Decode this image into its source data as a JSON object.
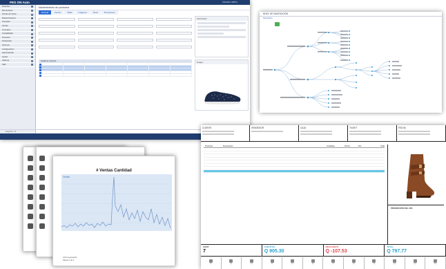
{
  "erp": {
    "logo": "PEG ON Auto",
    "user": "Usuario activo",
    "title": "Mantenimiento de productos",
    "tabs": [
      {
        "label": "General"
      },
      {
        "label": "Precios"
      },
      {
        "label": "Tallas"
      },
      {
        "label": "Imágenes"
      },
      {
        "label": "Stock"
      },
      {
        "label": "Proveedores"
      }
    ],
    "sidebar": [
      {
        "label": "Favoritos"
      },
      {
        "label": "Mis archivos"
      },
      {
        "label": "Puntos de Venta"
      },
      {
        "label": "Mantenimientos"
      },
      {
        "label": "Compras"
      },
      {
        "label": "Ventas"
      },
      {
        "label": "Inventario"
      },
      {
        "label": "Contabilidad"
      },
      {
        "label": "Tesorería"
      },
      {
        "label": "Producción"
      },
      {
        "label": "Informes"
      },
      {
        "label": "Configuración"
      },
      {
        "label": "Herramientas"
      },
      {
        "label": "Ayuda"
      },
      {
        "label": "Sistema"
      },
      {
        "label": "Salir"
      }
    ],
    "panel_right_title": "Información",
    "grid_title": "Detalle de artículos",
    "product_panel_title": "Imagen",
    "footer": "Registros: 12"
  },
  "tree": {
    "title": "NIVEL DE NAVEGACIÓN",
    "tabs": "Descripción",
    "nodes": [
      {
        "label": "Categoría"
      },
      {
        "label": "Calzado"
      },
      {
        "label": "Ropa"
      },
      {
        "label": "Accesorios"
      }
    ]
  },
  "report": {
    "chart_title": "# Ventas Cantidad",
    "legend": "Ventas",
    "footer_lines": [
      "Informe generado",
      "Página 1 de 3"
    ]
  },
  "pos": {
    "top_boxes": [
      {
        "label": "CLIENTE"
      },
      {
        "label": "VENDEDOR"
      },
      {
        "label": "CAJA"
      },
      {
        "label": "TICKET"
      },
      {
        "label": "FECHA"
      }
    ],
    "table_headers": [
      "Producto",
      "Descripción",
      "Unidades",
      "Precio",
      "Dto",
      "Total"
    ],
    "rows": [
      {
        "p": "",
        "d": "",
        "u": "",
        "pr": "",
        "dt": "",
        "t": ""
      },
      {
        "p": "",
        "d": "",
        "u": "",
        "pr": "",
        "dt": "",
        "t": ""
      },
      {
        "p": "",
        "d": "",
        "u": "",
        "pr": "",
        "dt": "",
        "t": ""
      },
      {
        "p": "",
        "d": "",
        "u": "",
        "pr": "",
        "dt": "",
        "t": ""
      },
      {
        "p": "",
        "d": "",
        "u": "",
        "pr": "",
        "dt": "",
        "t": ""
      },
      {
        "p": "",
        "d": "",
        "u": "",
        "pr": "",
        "dt": "",
        "t": ""
      },
      {
        "p": "",
        "d": "",
        "u": "",
        "pr": "",
        "dt": "",
        "t": ""
      },
      {
        "p": "",
        "d": "",
        "u": "",
        "pr": "",
        "dt": "",
        "t": ""
      }
    ],
    "promo_label": "PROMOCIÓN DEL DÍA",
    "totals": [
      {
        "label": "CANT",
        "value": "7",
        "style": "dark"
      },
      {
        "label": "SUBTOTAL",
        "value": "Q 905.30",
        "style": "blue"
      },
      {
        "label": "DESCUENTO",
        "value": "Q -107.53",
        "style": "red"
      },
      {
        "label": "TOTAL",
        "value": "Q 797.77",
        "style": "blue"
      }
    ],
    "keys": [
      {
        "label": "F1"
      },
      {
        "label": "F2"
      },
      {
        "label": "F3"
      },
      {
        "label": "F4"
      },
      {
        "label": "F5"
      },
      {
        "label": "F6"
      },
      {
        "label": "F7"
      },
      {
        "label": "F8"
      },
      {
        "label": "F9"
      },
      {
        "label": "F10"
      },
      {
        "label": "F11"
      },
      {
        "label": "F12"
      }
    ]
  },
  "colors": {
    "erp_header": "#1f3d6e",
    "accent_blue": "#2aa0d0",
    "discount_red": "#e0434b",
    "tree_node": "#3aa0d8",
    "selected_row": "#66c6ea"
  }
}
